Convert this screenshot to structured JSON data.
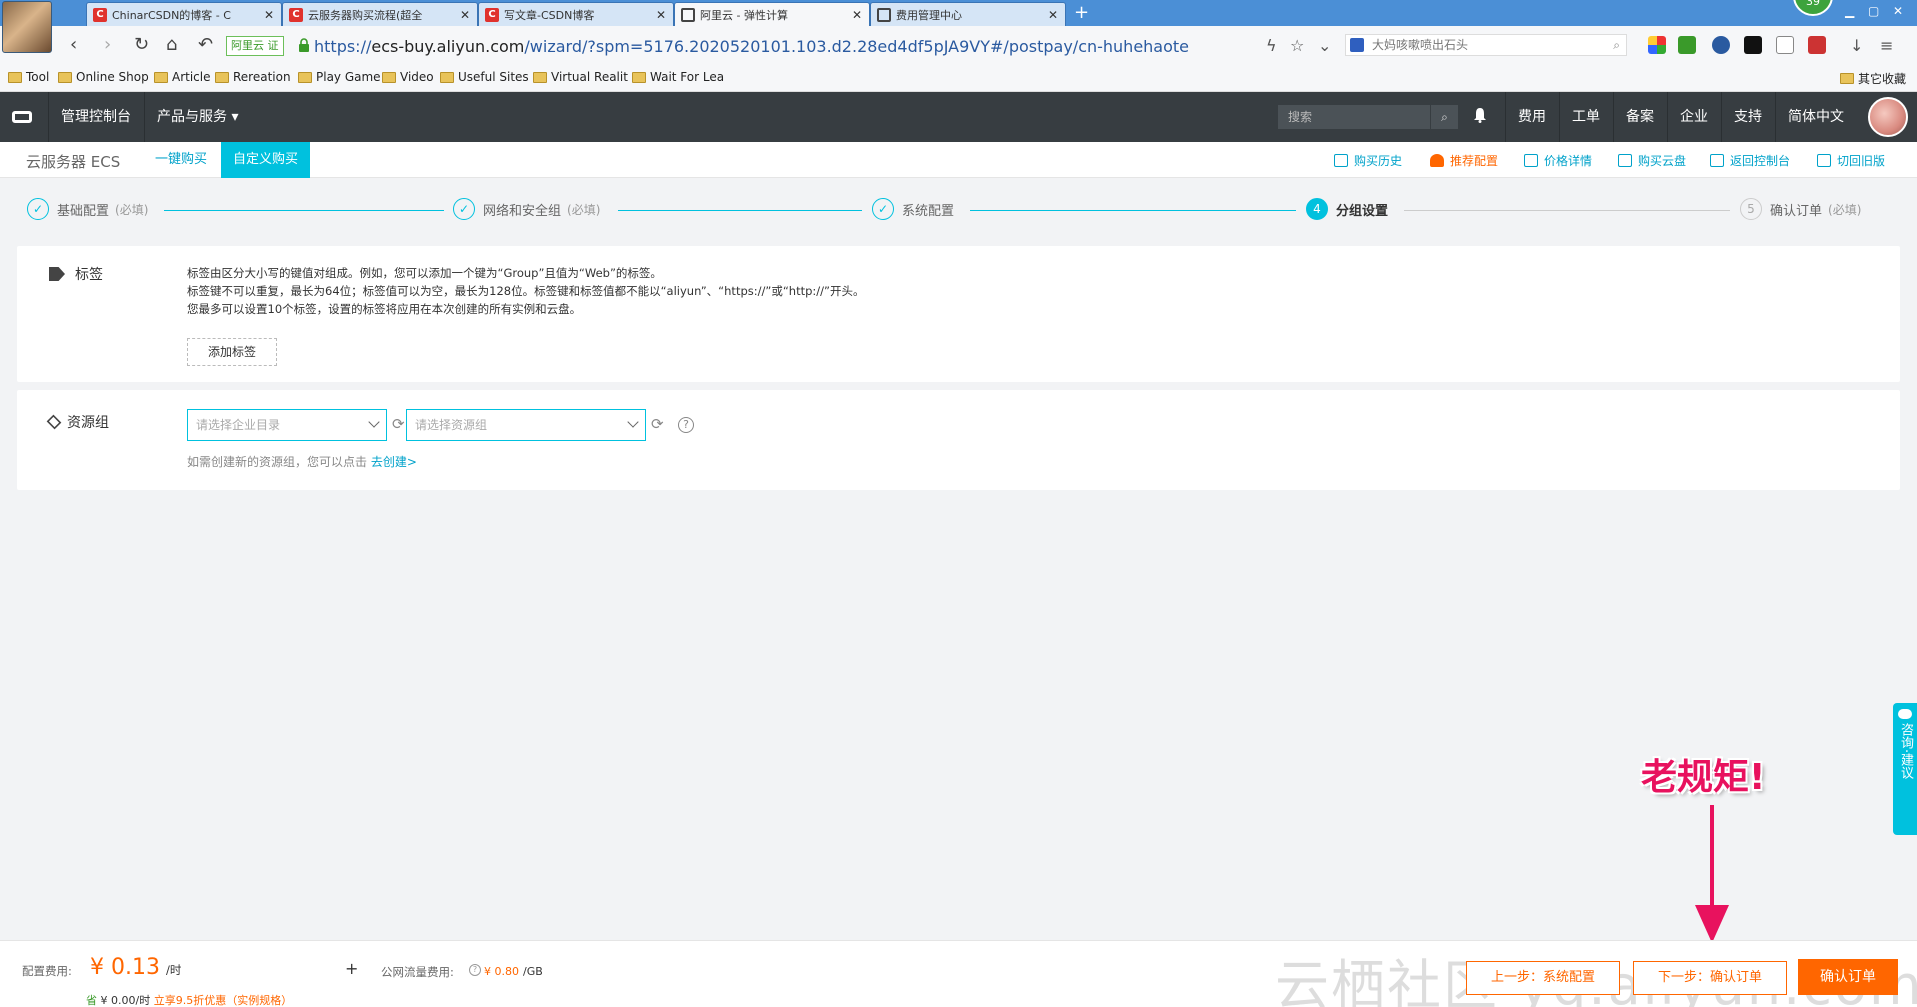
{
  "browser": {
    "tabs": [
      {
        "label": "ChinarCSDN的博客 - C",
        "icon": "csdn-icon"
      },
      {
        "label": "云服务器购买流程(超全",
        "icon": "csdn-icon"
      },
      {
        "label": "写文章-CSDN博客",
        "icon": "csdn-icon"
      },
      {
        "label": "阿里云 - 弹性计算",
        "icon": "aliyun-icon"
      },
      {
        "label": "费用管理中心",
        "icon": "aliyun-icon"
      }
    ],
    "notification_count": "39",
    "cert_label": "阿里云",
    "cert_badge": "证",
    "url_scheme": "https://",
    "url_domain": "ecs-buy.aliyun.com",
    "url_path": "/wizard/?spm=5176.2020520101.103.d2.28ed4df5pJA9VY#/postpay/cn-huhehaote",
    "search_text": "大妈咳嗽喷出石头",
    "bookmarks": [
      "Tool",
      "Online Shop",
      "Article",
      "Rereation",
      "Play Game",
      "Video",
      "Useful Sites",
      "Virtual Realit",
      "Wait For Lea"
    ],
    "other_bookmarks": "其它收藏"
  },
  "console": {
    "console_link": "管理控制台",
    "products_link": "产品与服务 ▾",
    "search_placeholder": "搜索",
    "nav": [
      "费用",
      "工单",
      "备案",
      "企业",
      "支持",
      "简体中文"
    ]
  },
  "subheader": {
    "product_title": "云服务器 ECS",
    "tab_quick": "一键购买",
    "tab_custom": "自定义购买",
    "links": [
      "购买历史",
      "推荐配置",
      "价格详情",
      "购买云盘",
      "返回控制台",
      "切回旧版"
    ]
  },
  "steps": [
    {
      "label": "基础配置",
      "req": "(必填)",
      "state": "done"
    },
    {
      "label": "网络和安全组",
      "req": "(必填)",
      "state": "done"
    },
    {
      "label": "系统配置",
      "req": "",
      "state": "done"
    },
    {
      "label": "分组设置",
      "req": "",
      "state": "current",
      "number": "4"
    },
    {
      "label": "确认订单",
      "req": "(必填)",
      "state": "future",
      "number": "5"
    }
  ],
  "tags": {
    "title": "标签",
    "desc1": "标签由区分大小写的键值对组成。例如，您可以添加一个键为“Group”且值为“Web”的标签。",
    "desc2": "标签键不可以重复，最长为64位；标签值可以为空，最长为128位。标签键和标签值都不能以“aliyun”、“https://”或“http://”开头。",
    "desc3": "您最多可以设置10个标签，设置的标签将应用在本次创建的所有实例和云盘。",
    "add_button": "添加标签"
  },
  "resource_group": {
    "title": "资源组",
    "enterprise_placeholder": "请选择企业目录",
    "group_placeholder": "请选择资源组",
    "hint": "如需创建新的资源组，您可以点击",
    "hint_link": "去创建>"
  },
  "side": {
    "consult": "咨询·建议"
  },
  "annotation": "老规矩!",
  "footer": {
    "cfg_label": "配置费用:",
    "price": "¥ 0.13",
    "price_unit": "/时",
    "traffic_label": "公网流量费用:",
    "traffic_price": "¥ 0.80",
    "traffic_unit": "/GB",
    "save_prefix": "省",
    "save_amount": "¥ 0.00",
    "save_unit": "/时",
    "save_discount": "立享9.5折优惠（实例规格）",
    "prev_button": "上一步：系统配置",
    "next_button": "下一步：确认订单",
    "confirm_button": "确认订单",
    "watermark": "云栖社区 yq.aliyun.com"
  },
  "colors": {
    "accent": "#00c1de",
    "orange": "#ff6600",
    "header": "#373d41",
    "annotation": "#e8125e"
  }
}
